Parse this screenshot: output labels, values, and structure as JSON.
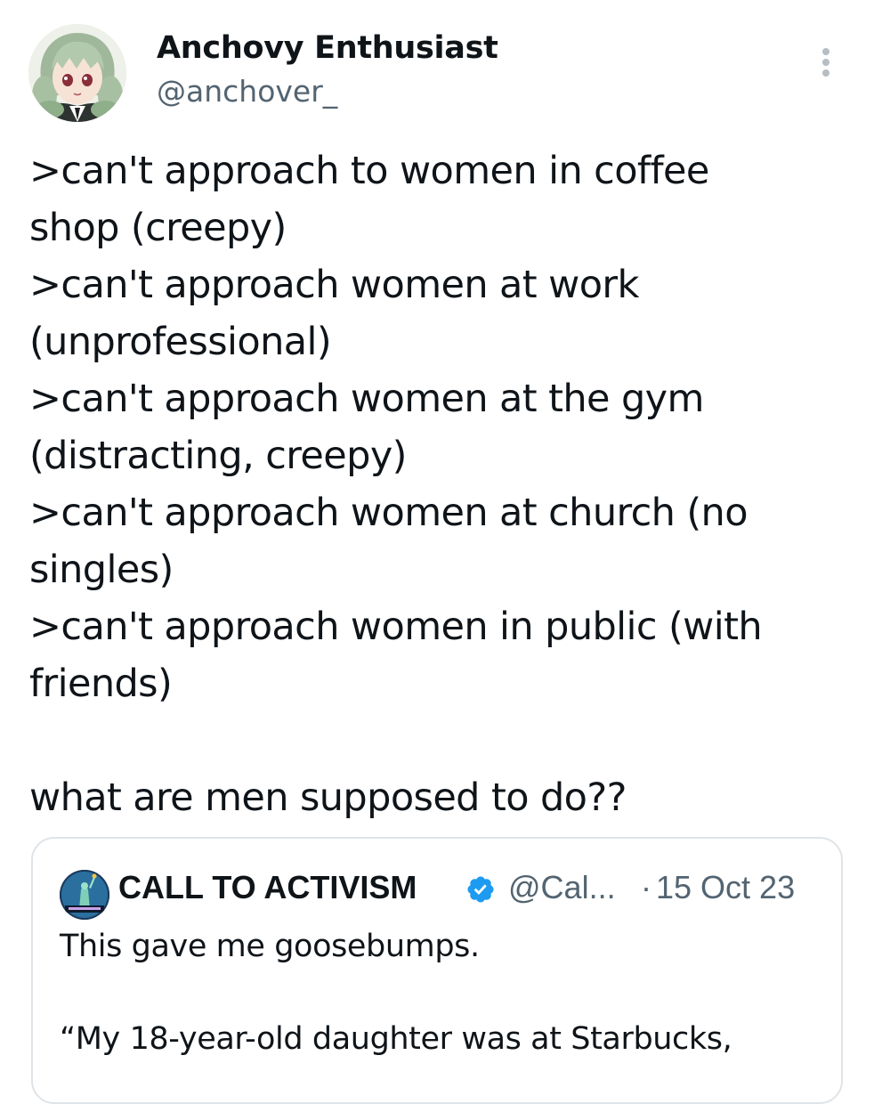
{
  "author": {
    "display_name": "Anchovy Enthusiast",
    "handle": "@anchover_",
    "avatar_icon": "anime-character-avatar"
  },
  "more_icon": "more-vertical-icon",
  "tweet": {
    "lines": [
      ">can't approach to women in coffee",
      "shop (creepy)",
      ">can't approach women at work",
      "(unprofessional)",
      ">can't approach women at the gym",
      "(distracting, creepy)",
      ">can't approach women at church (no",
      "singles)",
      ">can't approach women in public (with",
      "friends)"
    ],
    "closing": "what are men supposed to do??"
  },
  "quote": {
    "display_name": "CALL TO ACTIVISM",
    "verified_icon": "verified-badge-icon",
    "handle": "@Cal...",
    "separator": "·",
    "date": "15 Oct 23",
    "lines": [
      "This gave me goosebumps.",
      "“My 18-year-old daughter was at Starbucks,"
    ]
  },
  "colors": {
    "text_primary": "#0f1419",
    "text_secondary": "#536471",
    "border": "#dfe4e8",
    "verified": "#1d9bf0"
  }
}
